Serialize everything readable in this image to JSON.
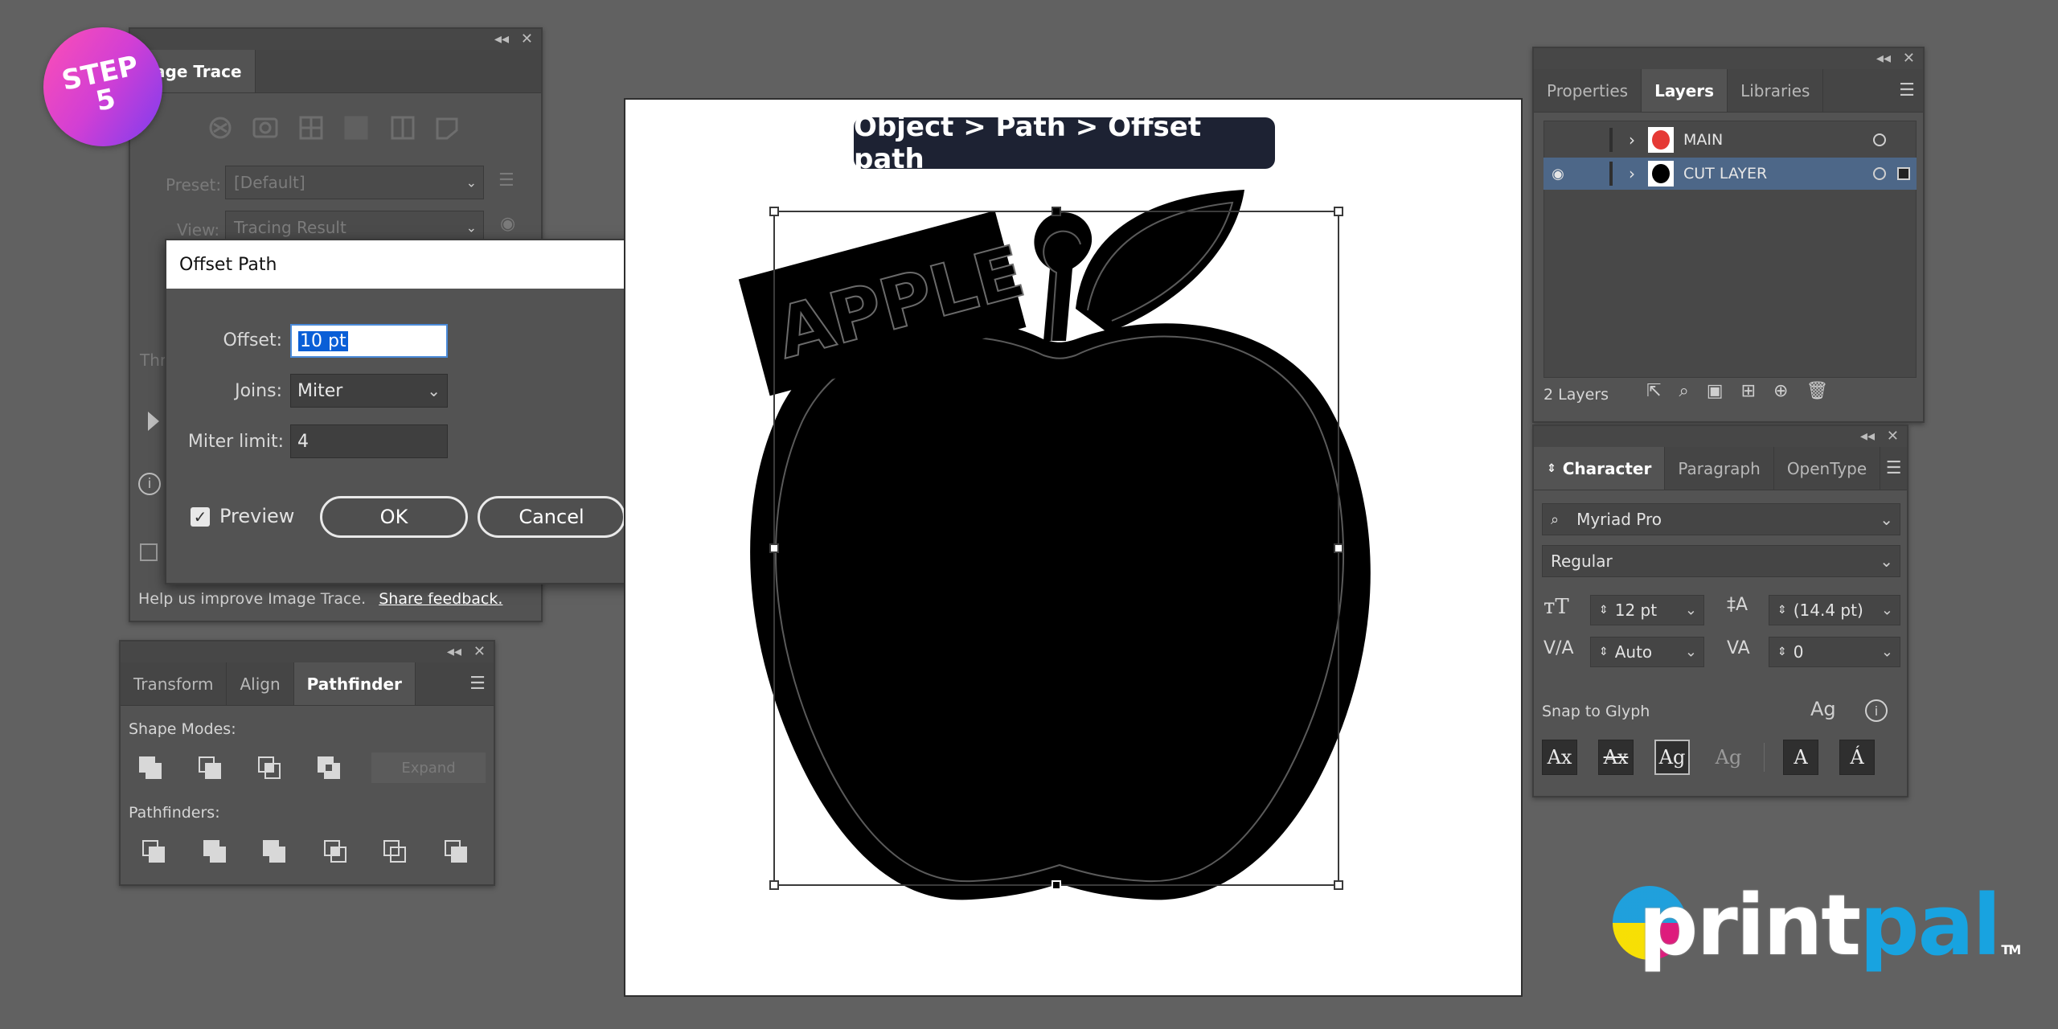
{
  "step_badge": {
    "line1": "STEP",
    "line2": "5"
  },
  "image_trace": {
    "title": "age Trace",
    "preset_label": "Preset:",
    "preset_value": "[Default]",
    "view_label": "View:",
    "view_value": "Tracing Result",
    "threshold_label": "Thr",
    "feedback_text": "Help us improve Image Trace.",
    "feedback_link": "Share feedback."
  },
  "offset_dialog": {
    "title": "Offset Path",
    "offset_label": "Offset:",
    "offset_value": "10 pt",
    "joins_label": "Joins:",
    "joins_value": "Miter",
    "miter_label": "Miter limit:",
    "miter_value": "4",
    "preview_label": "Preview",
    "ok_label": "OK",
    "cancel_label": "Cancel"
  },
  "pathfinder_panel": {
    "tabs": [
      "Transform",
      "Align",
      "Pathfinder"
    ],
    "active_tab": "Pathfinder",
    "shape_modes_label": "Shape Modes:",
    "expand_label": "Expand",
    "pathfinders_label": "Pathfinders:"
  },
  "canvas": {
    "callout": "Object > Path > Offset path",
    "artwork_text": "APPLE"
  },
  "layers_panel": {
    "tabs": [
      "Properties",
      "Layers",
      "Libraries"
    ],
    "active_tab": "Layers",
    "layers": [
      {
        "name": "MAIN",
        "visible": false,
        "selected": false,
        "thumb_color": "#e53935"
      },
      {
        "name": "CUT LAYER",
        "visible": true,
        "selected": true,
        "thumb_color": "#000000"
      }
    ],
    "count_label": "2 Layers"
  },
  "character_panel": {
    "tabs": [
      "Character",
      "Paragraph",
      "OpenType"
    ],
    "active_tab": "Character",
    "font_family": "Myriad Pro",
    "font_style": "Regular",
    "font_size": "12 pt",
    "leading": "(14.4 pt)",
    "kerning": "Auto",
    "tracking": "0",
    "snap_label": "Snap to Glyph"
  },
  "brand": {
    "part1": "print",
    "part2": "pal",
    "tm": "TM"
  },
  "colors": {
    "workspace": "#616161",
    "panel": "#535353",
    "selection_blue": "#0a5fd7",
    "layer_selected": "#4d6788",
    "brand_gray": "#ffffff",
    "brand_blue": "#18a3e0"
  }
}
